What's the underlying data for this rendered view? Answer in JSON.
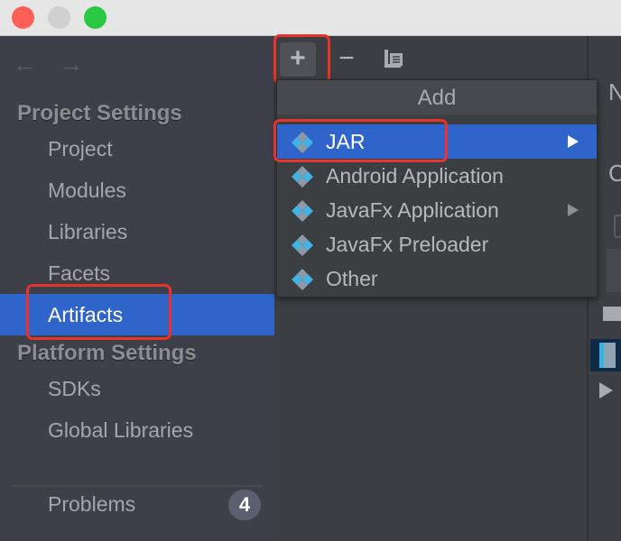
{
  "window": {
    "traffic_lights": {
      "close": "#fe5f57",
      "minimize": "#d0d0d0",
      "maximize": "#28c840"
    }
  },
  "sidebar": {
    "nav": {
      "back": "←",
      "forward": "→"
    },
    "sections": [
      {
        "title": "Project Settings"
      },
      {
        "title": "Platform Settings"
      }
    ],
    "items": [
      {
        "label": "Project"
      },
      {
        "label": "Modules"
      },
      {
        "label": "Libraries"
      },
      {
        "label": "Facets"
      },
      {
        "label": "Artifacts",
        "selected": true
      },
      {
        "label": "SDKs"
      },
      {
        "label": "Global Libraries"
      }
    ],
    "problems": {
      "label": "Problems",
      "count": "4"
    }
  },
  "toolbar": {
    "add": "+",
    "remove": "−"
  },
  "menu": {
    "title": "Add",
    "items": [
      {
        "label": "JAR",
        "selected": true,
        "submenu": true
      },
      {
        "label": "Android Application"
      },
      {
        "label": "JavaFx Application",
        "submenu": true
      },
      {
        "label": "JavaFx Preloader"
      },
      {
        "label": "Other"
      }
    ]
  },
  "right_panel": {
    "label1": "N",
    "label2": "C"
  },
  "colors": {
    "accent": "#2f65ca",
    "highlight": "#e8322a"
  }
}
